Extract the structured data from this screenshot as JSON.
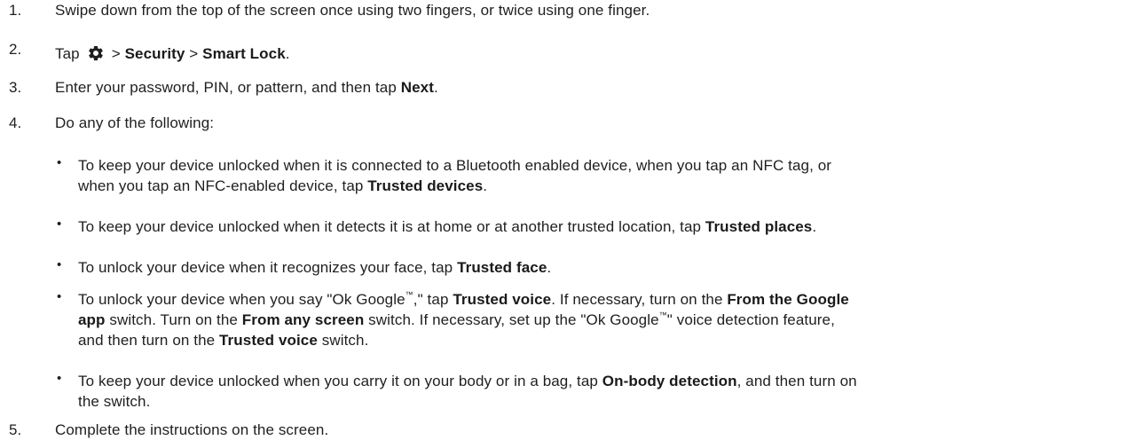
{
  "steps": [
    {
      "num": "1.",
      "text": "Swipe down from the top of the screen once using two fingers, or twice using one finger."
    },
    {
      "num": "2.",
      "pre": "Tap",
      "gear_icon": "settings-gear-icon",
      "sep1": ">",
      "b1": "Security",
      "sep2": ">",
      "b2": "Smart Lock",
      "end": "."
    },
    {
      "num": "3.",
      "pre": "Enter your password, PIN, or pattern, and then tap",
      "b1": "Next",
      "end": "."
    },
    {
      "num": "4.",
      "text": "Do any of the following:"
    },
    {
      "num": "5.",
      "text": "Complete the instructions on the screen."
    }
  ],
  "bullets": [
    {
      "bullet": "•",
      "l1": "To keep your device unlocked when it is connected to a Bluetooth enabled device, when you tap an NFC tag, or",
      "l2_pre": "when you tap an NFC-enabled device, tap",
      "l2_b": "Trusted devices",
      "l2_end": "."
    },
    {
      "bullet": "•",
      "pre": "To keep your device unlocked when it detects it is at home or at another trusted location, tap",
      "b": "Trusted places",
      "end": "."
    },
    {
      "bullet": "•",
      "pre": "To unlock your device when it recognizes your face, tap",
      "b": "Trusted face",
      "end": "."
    },
    {
      "bullet": "•",
      "l1_pre": "To unlock your device when you say \"Ok Google",
      "tm": "™",
      "l1_mid": ",\" tap",
      "l1_b1": "Trusted voice",
      "l1_mid2": ". If necessary, turn on the",
      "l1_b2": "From the Google",
      "l2_b": "app",
      "l2_mid": "switch. Turn on the",
      "l2_b2": "From any screen",
      "l2_mid2": "switch. If necessary, set up the \"Ok Google",
      "l2_end": "\" voice detection feature,",
      "l3_pre": "and then turn on the",
      "l3_b": "Trusted voice",
      "l3_end": "switch."
    },
    {
      "bullet": "•",
      "l1_pre": "To keep your device unlocked when you carry it on your body or in a bag, tap",
      "l1_b": "On-body detection",
      "l1_end": ", and then turn on",
      "l2": "the switch."
    }
  ]
}
